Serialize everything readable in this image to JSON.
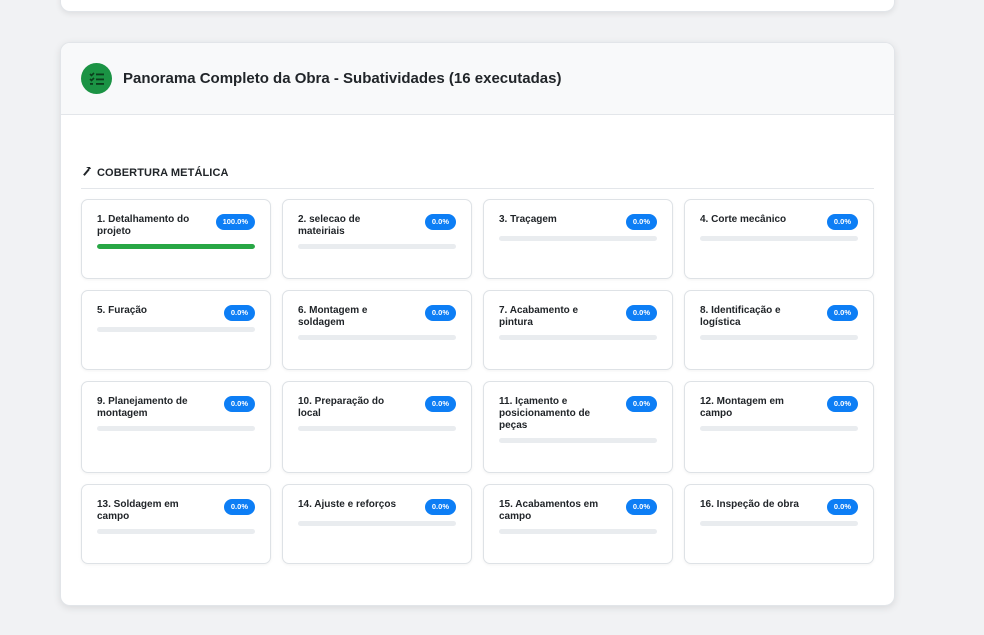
{
  "panel": {
    "title": "Panorama Completo da Obra - Subatividades (16 executadas)",
    "icon": "list-check-icon",
    "accent": "#1b9344"
  },
  "section": {
    "title": "COBERTURA METÁLICA",
    "icon": "hammer-icon"
  },
  "colors": {
    "badge": "#0d7ef5",
    "progress": "#28a745",
    "track": "#e9ecef"
  },
  "subactivities": [
    {
      "name": "1. Detalhamento do projeto",
      "percent_label": "100.0%",
      "progress": 100
    },
    {
      "name": "2. selecao de mateiriais",
      "percent_label": "0.0%",
      "progress": 0
    },
    {
      "name": "3. Traçagem",
      "percent_label": "0.0%",
      "progress": 0
    },
    {
      "name": "4. Corte mecânico",
      "percent_label": "0.0%",
      "progress": 0
    },
    {
      "name": "5. Furação",
      "percent_label": "0.0%",
      "progress": 0
    },
    {
      "name": "6. Montagem e soldagem",
      "percent_label": "0.0%",
      "progress": 0
    },
    {
      "name": "7. Acabamento e pintura",
      "percent_label": "0.0%",
      "progress": 0
    },
    {
      "name": "8. Identificação e logística",
      "percent_label": "0.0%",
      "progress": 0
    },
    {
      "name": "9. Planejamento de montagem",
      "percent_label": "0.0%",
      "progress": 0
    },
    {
      "name": "10. Preparação do local",
      "percent_label": "0.0%",
      "progress": 0
    },
    {
      "name": "11. Içamento e posicionamento de peças",
      "percent_label": "0.0%",
      "progress": 0
    },
    {
      "name": "12. Montagem em campo",
      "percent_label": "0.0%",
      "progress": 0
    },
    {
      "name": "13. Soldagem em campo",
      "percent_label": "0.0%",
      "progress": 0
    },
    {
      "name": "14. Ajuste e reforços",
      "percent_label": "0.0%",
      "progress": 0
    },
    {
      "name": "15. Acabamentos em campo",
      "percent_label": "0.0%",
      "progress": 0
    },
    {
      "name": "16. Inspeção de obra",
      "percent_label": "0.0%",
      "progress": 0
    }
  ]
}
